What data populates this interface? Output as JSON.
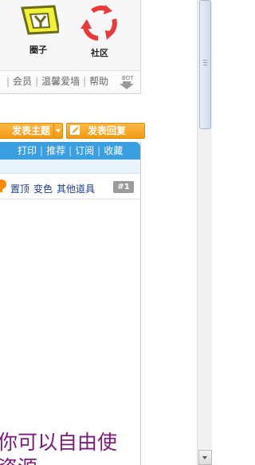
{
  "nav": {
    "icons": [
      {
        "name": "quanzi",
        "label": "圈子"
      },
      {
        "name": "shequ",
        "label": "社区"
      }
    ],
    "links": [
      "会员",
      "温馨爱墙",
      "帮助"
    ],
    "bot_label": "BOT"
  },
  "actions": {
    "post_label": "发表主题",
    "reply_label": "发表回复"
  },
  "toolbar": {
    "items": [
      "打印",
      "推荐",
      "订阅",
      "收藏"
    ]
  },
  "post_tools": {
    "items": [
      "置顶",
      "变色",
      "其他道具"
    ],
    "floor": "#1"
  },
  "body": {
    "line1": "你可以自由使",
    "line2": "资源"
  },
  "colors": {
    "accent_orange": "#f39a11",
    "toolbar_blue": "#3a9fe0",
    "body_purple": "#7a1b7a"
  }
}
